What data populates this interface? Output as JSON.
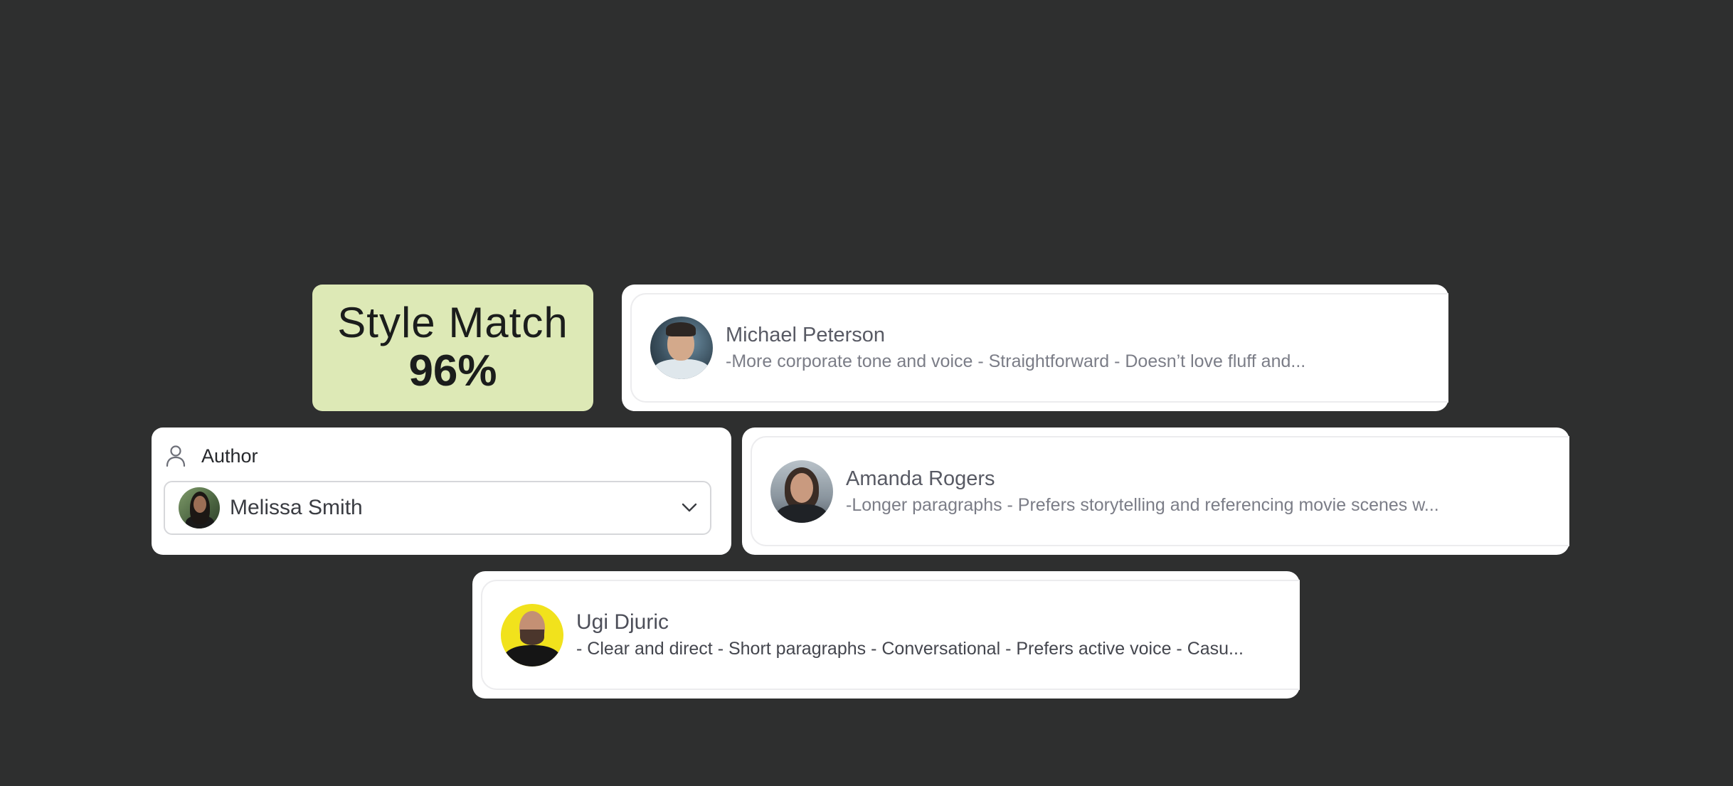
{
  "style_match": {
    "title": "Style Match",
    "value": "96%",
    "background_color": "#dde9b6"
  },
  "author_select": {
    "icon": "user-icon",
    "label": "Author",
    "selected_value": "Melissa Smith",
    "chevron_icon": "chevron-down-icon"
  },
  "authors": [
    {
      "name": "Michael Peterson",
      "description": "-More corporate tone and voice - Straightforward - Doesn’t love fluff and..."
    },
    {
      "name": "Amanda Rogers",
      "description": "-Longer paragraphs - Prefers storytelling and referencing movie scenes w..."
    },
    {
      "name": "Ugi Djuric",
      "description": "- Clear and direct - Short paragraphs - Conversational - Prefers active voice - Casu..."
    }
  ],
  "colors": {
    "background": "#2e2f2f",
    "card": "#ffffff"
  }
}
